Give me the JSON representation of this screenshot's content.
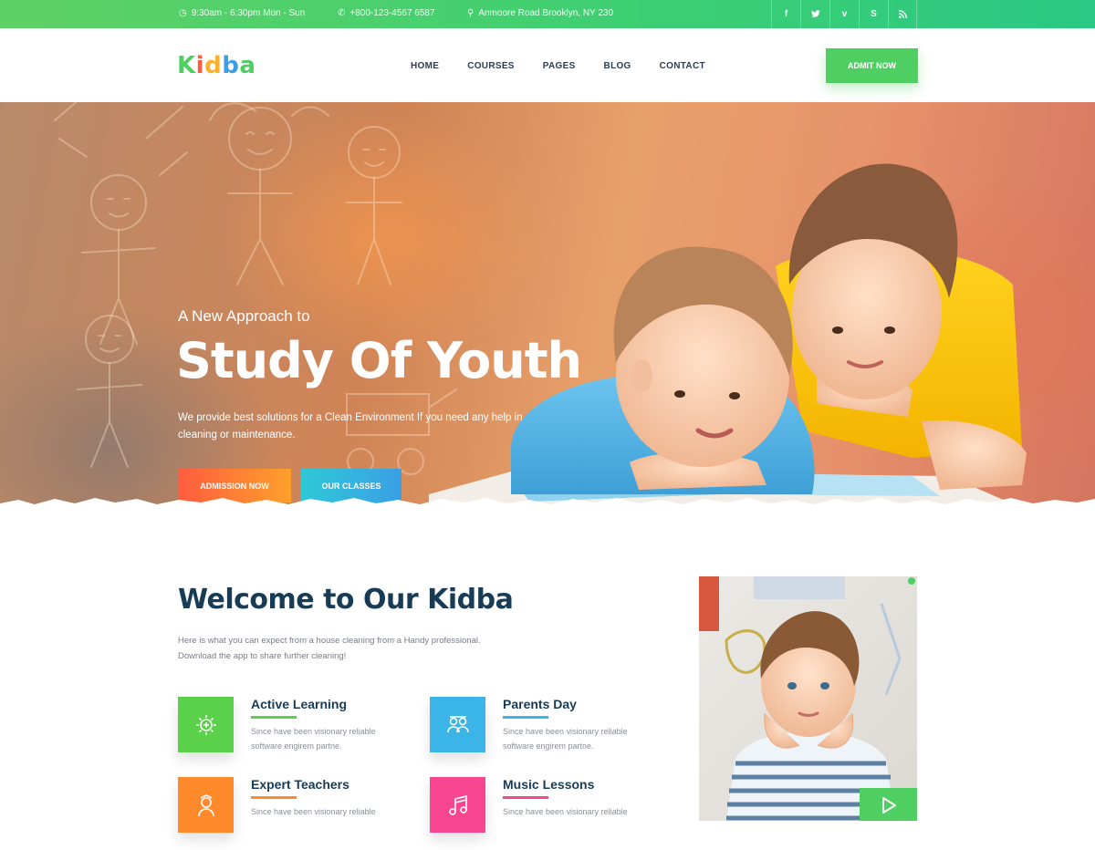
{
  "topbar": {
    "hours": "9:30am - 6:30pm Mon - Sun",
    "phone": "+800-123-4567 6587",
    "address": "Anmoore Road Brooklyn, NY 230",
    "icons": [
      "clock-icon",
      "phone-icon",
      "map-pin-icon"
    ],
    "socials": [
      "facebook",
      "twitter",
      "vimeo",
      "skype",
      "rss"
    ],
    "colors": {
      "gradient_start": "#5fd065",
      "gradient_end": "#2ac883"
    }
  },
  "header": {
    "logo_letters": [
      "K",
      "i",
      "d",
      "b",
      "a"
    ],
    "logo_colors": [
      "#4fcf62",
      "#ff5c3e",
      "#ffb02b",
      "#3a9fe6",
      "#4fcf62"
    ],
    "nav": [
      "HOME",
      "COURSES",
      "PAGES",
      "BLOG",
      "CONTACT"
    ],
    "cta": "ADMIT NOW",
    "accent": "#4fcf62"
  },
  "hero": {
    "kicker": "A New Approach to",
    "title": "Study Of Youth",
    "description": "We provide best solutions for a Clean Environment If you need any help in cleaning or maintenance.",
    "buttons": {
      "admission": "ADMISSION NOW",
      "classes": "OUR CLASSES"
    }
  },
  "welcome": {
    "title": "Welcome to Our Kidba",
    "description": "Here is what you can expect from a house cleaning from a Handy professional. Download the app to share further cleaning!",
    "features": [
      {
        "title": "Active Learning",
        "text": "Since have been visionary reliable software engirem partne.",
        "icon": "brain-icon",
        "color": "#5bd04a"
      },
      {
        "title": "Parents Day",
        "text": "Since have been visionary reliable software engirem partne.",
        "icon": "people-icon",
        "color": "#3bb4e8"
      },
      {
        "title": "Expert Teachers",
        "text": "Since have been visionary reliable",
        "icon": "teacher-icon",
        "color": "#ff8a2b"
      },
      {
        "title": "Music Lessons",
        "text": "Since have been visionary reliable",
        "icon": "music-icon",
        "color": "#f7458f"
      }
    ],
    "play_icon": "play-icon"
  }
}
